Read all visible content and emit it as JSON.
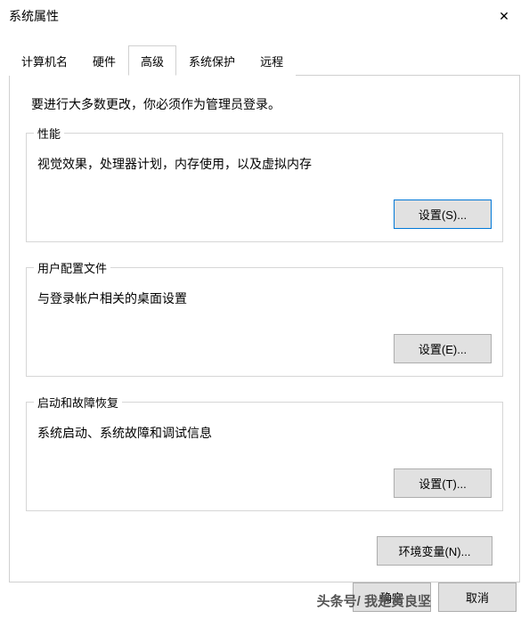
{
  "titlebar": {
    "title": "系统属性"
  },
  "tabs": {
    "t0": "计算机名",
    "t1": "硬件",
    "t2": "高级",
    "t3": "系统保护",
    "t4": "远程",
    "active_index": 2
  },
  "instruction": "要进行大多数更改，你必须作为管理员登录。",
  "groups": {
    "performance": {
      "title": "性能",
      "desc": "视觉效果，处理器计划，内存使用，以及虚拟内存",
      "button": "设置(S)..."
    },
    "user_profiles": {
      "title": "用户配置文件",
      "desc": "与登录帐户相关的桌面设置",
      "button": "设置(E)..."
    },
    "startup": {
      "title": "启动和故障恢复",
      "desc": "系统启动、系统故障和调试信息",
      "button": "设置(T)..."
    }
  },
  "env_button": "环境变量(N)...",
  "bottom": {
    "ok": "确定",
    "cancel": "取消"
  },
  "watermark": "头条号/ 我是黄良坚"
}
